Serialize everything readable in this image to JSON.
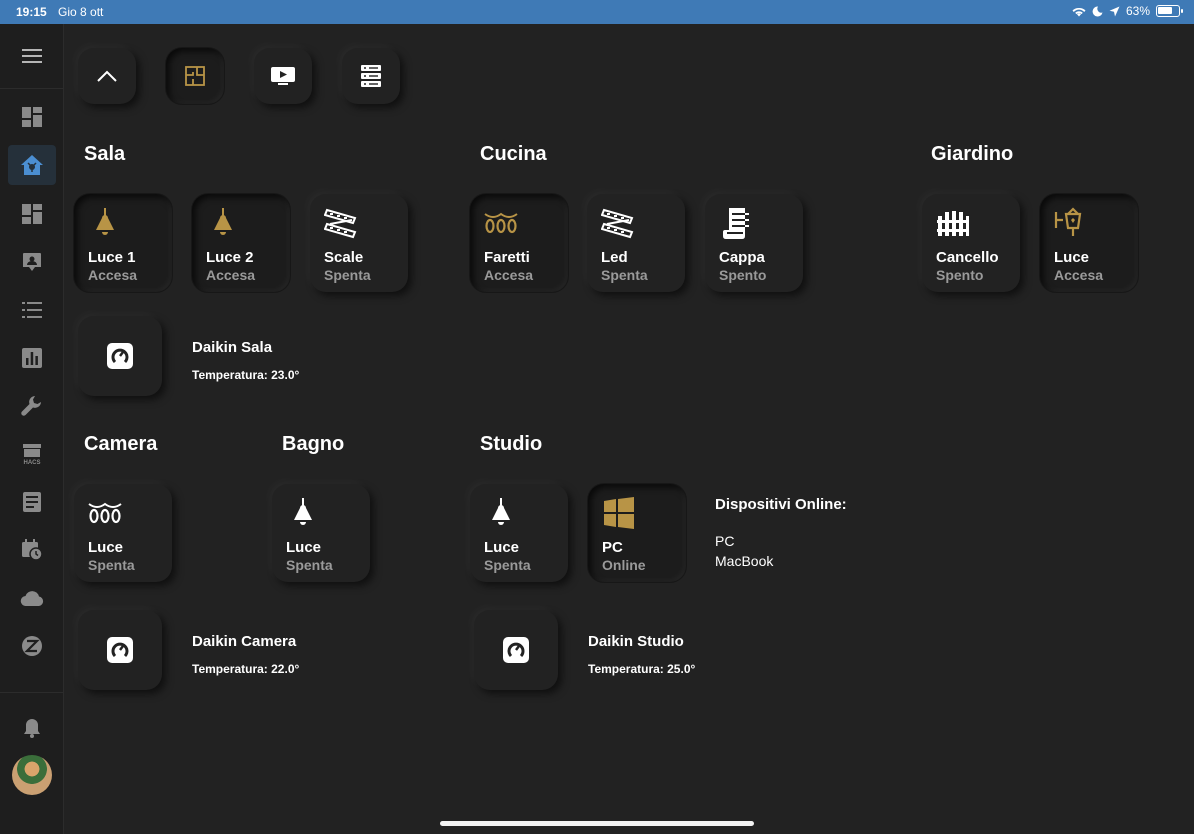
{
  "status_bar": {
    "time": "19:15",
    "date": "Gio 8 ott",
    "battery": "63%",
    "battery_level": 0.63
  },
  "sidebar": {
    "items": [
      {
        "icon": "overview-dashboard-icon"
      },
      {
        "icon": "home-dashboard-icon",
        "active": true
      },
      {
        "icon": "dashboard-icon"
      },
      {
        "icon": "account-box-icon"
      },
      {
        "icon": "list-icon"
      },
      {
        "icon": "chart-icon"
      },
      {
        "icon": "wrench-icon"
      },
      {
        "icon": "hacs-store-icon",
        "label": "HACS"
      },
      {
        "icon": "log-icon"
      },
      {
        "icon": "calendar-clock-icon"
      },
      {
        "icon": "cloud-icon"
      },
      {
        "icon": "zwave-icon"
      }
    ],
    "notifications_icon": "bell-icon"
  },
  "top_nav": [
    {
      "icon": "roof-icon"
    },
    {
      "icon": "floorplan-icon",
      "active": true
    },
    {
      "icon": "tv-icon"
    },
    {
      "icon": "server-icon"
    }
  ],
  "sections": {
    "sala": {
      "title": "Sala"
    },
    "cucina": {
      "title": "Cucina"
    },
    "giardino": {
      "title": "Giardino"
    },
    "camera": {
      "title": "Camera"
    },
    "bagno": {
      "title": "Bagno"
    },
    "studio": {
      "title": "Studio"
    }
  },
  "tiles": {
    "sala_luce1": {
      "name": "Luce 1",
      "state": "Accesa"
    },
    "sala_luce2": {
      "name": "Luce 2",
      "state": "Accesa"
    },
    "sala_scale": {
      "name": "Scale",
      "state": "Spenta"
    },
    "cucina_faretti": {
      "name": "Faretti",
      "state": "Accesa"
    },
    "cucina_led": {
      "name": "Led",
      "state": "Spenta"
    },
    "cucina_cappa": {
      "name": "Cappa",
      "state": "Spento"
    },
    "giardino_cancello": {
      "name": "Cancello",
      "state": "Spento"
    },
    "giardino_luce": {
      "name": "Luce",
      "state": "Accesa"
    },
    "camera_luce": {
      "name": "Luce",
      "state": "Spenta"
    },
    "bagno_luce": {
      "name": "Luce",
      "state": "Spenta"
    },
    "studio_luce": {
      "name": "Luce",
      "state": "Spenta"
    },
    "studio_pc": {
      "name": "PC",
      "state": "Online"
    }
  },
  "climates": {
    "sala": {
      "name": "Daikin Sala",
      "temp": "Temperatura: 23.0°"
    },
    "camera": {
      "name": "Daikin Camera",
      "temp": "Temperatura: 22.0°"
    },
    "studio": {
      "name": "Daikin Studio",
      "temp": "Temperatura: 25.0°"
    }
  },
  "devices": {
    "title": "Dispositivi Online:",
    "items": [
      "PC",
      "MacBook"
    ]
  },
  "colors": {
    "accent_on": "#b89446",
    "icon_off": "#ffffff",
    "state_text": "#9a9a9a",
    "status_bar": "#3f7ab6"
  }
}
